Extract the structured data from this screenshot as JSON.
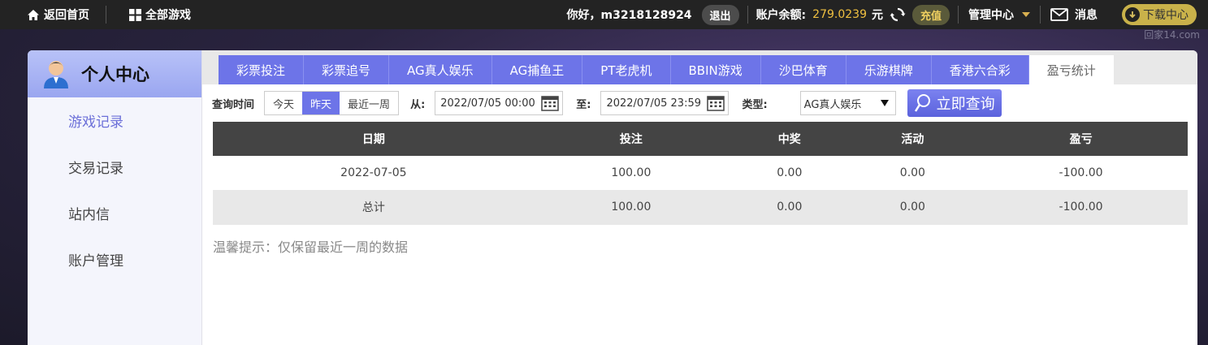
{
  "topbar": {
    "home": "返回首页",
    "all_games": "全部游戏",
    "greeting": "你好，m3218128924",
    "logout": "退出",
    "balance_label": "账户余额:",
    "balance_value": "279.0239",
    "balance_unit": "元",
    "recharge": "充值",
    "manage": "管理中心",
    "messages": "消息",
    "download": "下载中心",
    "watermark": "回家14.com"
  },
  "sidebar": {
    "title": "个人中心",
    "items": [
      "游戏记录",
      "交易记录",
      "站内信",
      "账户管理"
    ]
  },
  "tabs": [
    "彩票投注",
    "彩票追号",
    "AG真人娱乐",
    "AG捕鱼王",
    "PT老虎机",
    "BBIN游戏",
    "沙巴体育",
    "乐游棋牌",
    "香港六合彩",
    "盈亏统计"
  ],
  "filters": {
    "query_time_label": "查询时间",
    "ranges": [
      "今天",
      "昨天",
      "最近一周"
    ],
    "from_label": "从:",
    "from_value": "2022/07/05 00:00",
    "to_label": "至:",
    "to_value": "2022/07/05 23:59",
    "type_label": "类型:",
    "type_value": "AG真人娱乐",
    "search_button": "立即查询"
  },
  "table": {
    "headers": [
      "日期",
      "投注",
      "中奖",
      "活动",
      "盈亏"
    ],
    "rows": [
      [
        "2022-07-05",
        "100.00",
        "0.00",
        "0.00",
        "-100.00"
      ]
    ],
    "total": [
      "总计",
      "100.00",
      "0.00",
      "0.00",
      "-100.00"
    ]
  },
  "tip": "温馨提示：仅保留最近一周的数据",
  "colors": {
    "accent": "#6d74e8",
    "topbar": "#232323",
    "balance": "#f0c040"
  }
}
